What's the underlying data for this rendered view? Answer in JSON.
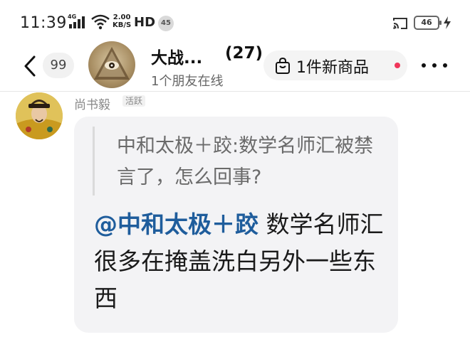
{
  "status_bar": {
    "time": "11:39",
    "network": "4G",
    "speed_value": "2.00",
    "speed_unit": "KB/S",
    "hd": "HD",
    "notification_count": "45",
    "battery": "46"
  },
  "header": {
    "unread_count": "99",
    "group_name": "大战...",
    "member_count": "(27)",
    "online_status": "1个朋友在线",
    "new_item_label": "1件新商品",
    "icons": [
      "back-chevron-icon",
      "bag-icon",
      "more-dots-icon"
    ]
  },
  "message": {
    "sender_name": "尚书毅",
    "sender_tag": "活跃",
    "quote_text": "中和太极＋跤:数学名师汇被禁言了，怎么回事?",
    "mention": "@中和太极＋跤",
    "reply_text": " 数学名师汇很多在掩盖洗白另外一些东西"
  },
  "colors": {
    "mention": "#1f5d9c",
    "bubble": "#f3f3f5",
    "red_dot": "#f0365a"
  }
}
